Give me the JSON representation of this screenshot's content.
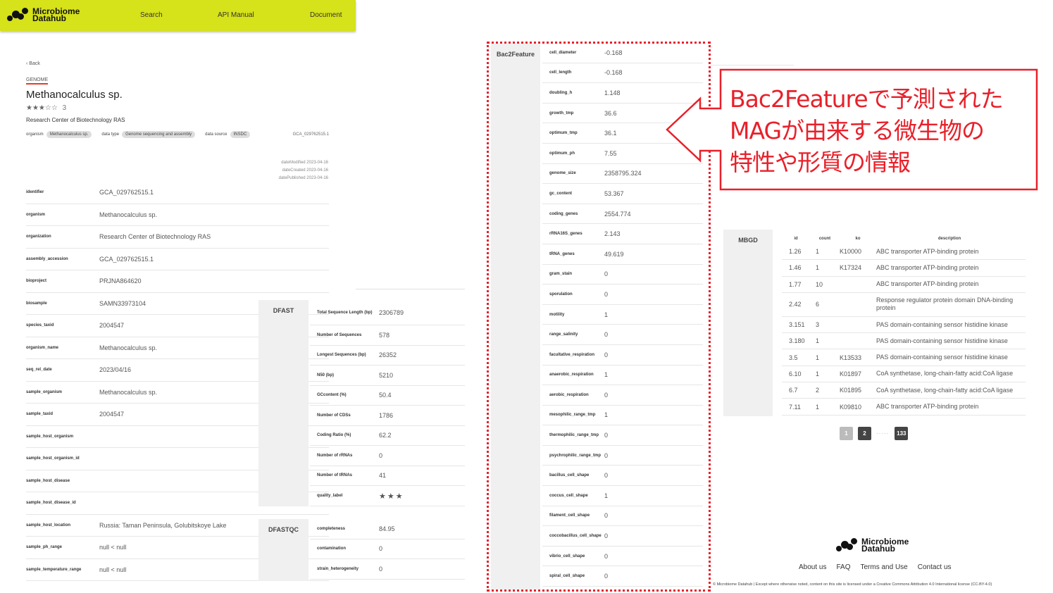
{
  "header": {
    "logo_line1": "Microbiome",
    "logo_line2": "Datahub",
    "nav": [
      "Search",
      "API Manual",
      "Document"
    ]
  },
  "left": {
    "back": "‹ Back",
    "type_tag": "GENOME",
    "title": "Methanocalculus sp.",
    "stars": "★★★☆☆",
    "rating_value": "3",
    "organization": "Research Center of Biotechnology RAS",
    "meta": [
      {
        "label": "organism",
        "value": "Methanocalculus sp."
      },
      {
        "label": "data type",
        "value": "Genome sequencing and assembly"
      },
      {
        "label": "data source",
        "value": "INSDC"
      }
    ],
    "accession_right": "GCA_029762515.1",
    "dates": [
      "dateModified 2023-04-16",
      "dateCreated 2023-04-16",
      "datePublished 2023-04-16"
    ],
    "rows": [
      {
        "k": "identifier",
        "v": "GCA_029762515.1"
      },
      {
        "k": "organism",
        "v": "Methanocalculus sp."
      },
      {
        "k": "organization",
        "v": "Research Center of Biotechnology RAS"
      },
      {
        "k": "assembly_accession",
        "v": "GCA_029762515.1"
      },
      {
        "k": "bioproject",
        "v": "PRJNA864620"
      },
      {
        "k": "biosample",
        "v": "SAMN33973104"
      },
      {
        "k": "species_taxid",
        "v": "2004547"
      },
      {
        "k": "organism_name",
        "v": "Methanocalculus sp."
      },
      {
        "k": "seq_rel_date",
        "v": "2023/04/16"
      },
      {
        "k": "sample_organism",
        "v": "Methanocalculus sp."
      },
      {
        "k": "sample_taxid",
        "v": "2004547"
      },
      {
        "k": "sample_host_organism",
        "v": ""
      },
      {
        "k": "sample_host_organism_id",
        "v": ""
      },
      {
        "k": "sample_host_disease",
        "v": ""
      },
      {
        "k": "sample_host_disease_id",
        "v": ""
      },
      {
        "k": "sample_host_location",
        "v": "Russia: Taman Peninsula, Golubitskoye Lake"
      },
      {
        "k": "sample_ph_range",
        "v": "null < null"
      },
      {
        "k": "sample_temperature_range",
        "v": "null < null"
      }
    ]
  },
  "dfast": {
    "label": "DFAST",
    "rows": [
      {
        "k": "Total Sequence Length (bp)",
        "v": "2306789"
      },
      {
        "k": "Number of Sequences",
        "v": "578"
      },
      {
        "k": "Longest Sequences (bp)",
        "v": "26352"
      },
      {
        "k": "N50 (bp)",
        "v": "5210"
      },
      {
        "k": "GCcontent (%)",
        "v": "50.4"
      },
      {
        "k": "Number of CDSs",
        "v": "1786"
      },
      {
        "k": "Coding Ratio (%)",
        "v": "62.2"
      },
      {
        "k": "Number of rRNAs",
        "v": "0"
      },
      {
        "k": "Number of tRNAs",
        "v": "41"
      },
      {
        "k": "quality_label",
        "v": "★★★"
      }
    ]
  },
  "dfastqc": {
    "label": "DFASTQC",
    "rows": [
      {
        "k": "completeness",
        "v": "84.95"
      },
      {
        "k": "contamination",
        "v": "0"
      },
      {
        "k": "strain_heterogeneity",
        "v": "0"
      }
    ]
  },
  "bac2feature": {
    "label": "Bac2Feature",
    "rows": [
      {
        "k": "cell_diameter",
        "v": "-0.168"
      },
      {
        "k": "cell_length",
        "v": "-0.168"
      },
      {
        "k": "doubling_h",
        "v": "1.148"
      },
      {
        "k": "growth_tmp",
        "v": "36.6"
      },
      {
        "k": "optimum_tmp",
        "v": "36.1"
      },
      {
        "k": "optimum_ph",
        "v": "7.55"
      },
      {
        "k": "genome_size",
        "v": "2358795.324"
      },
      {
        "k": "gc_content",
        "v": "53.367"
      },
      {
        "k": "coding_genes",
        "v": "2554.774"
      },
      {
        "k": "rRNA16S_genes",
        "v": "2.143"
      },
      {
        "k": "tRNA_genes",
        "v": "49.619"
      },
      {
        "k": "gram_stain",
        "v": "0"
      },
      {
        "k": "sporulation",
        "v": "0"
      },
      {
        "k": "motility",
        "v": "1"
      },
      {
        "k": "range_salinity",
        "v": "0"
      },
      {
        "k": "facultative_respiration",
        "v": "0"
      },
      {
        "k": "anaerobic_respiration",
        "v": "1"
      },
      {
        "k": "aerobic_respiration",
        "v": "0"
      },
      {
        "k": "mesophilic_range_tmp",
        "v": "1"
      },
      {
        "k": "thermophilic_range_tmp",
        "v": "0"
      },
      {
        "k": "psychrophilic_range_tmp",
        "v": "0"
      },
      {
        "k": "bacillus_cell_shape",
        "v": "0"
      },
      {
        "k": "coccus_cell_shape",
        "v": "1"
      },
      {
        "k": "filament_cell_shape",
        "v": "0"
      },
      {
        "k": "coccobacillus_cell_shape",
        "v": "0"
      },
      {
        "k": "vibrio_cell_shape",
        "v": "0"
      },
      {
        "k": "spiral_cell_shape",
        "v": "0"
      }
    ]
  },
  "callout": {
    "lines": [
      "Bac2Featureで予測された",
      "MAGが由来する微生物の",
      "特性や形質の情報"
    ],
    "color": "#e8202a"
  },
  "mbgd": {
    "label": "MBGD",
    "headers": {
      "id": "id",
      "count": "count",
      "ko": "ko",
      "description": "description"
    },
    "rows": [
      {
        "id": "1.26",
        "count": "1",
        "ko": "K10000",
        "desc": "ABC transporter ATP-binding protein"
      },
      {
        "id": "1.46",
        "count": "1",
        "ko": "K17324",
        "desc": "ABC transporter ATP-binding protein"
      },
      {
        "id": "1.77",
        "count": "10",
        "ko": "",
        "desc": "ABC transporter ATP-binding protein"
      },
      {
        "id": "2.42",
        "count": "6",
        "ko": "",
        "desc": "Response regulator protein domain DNA-binding protein"
      },
      {
        "id": "3.151",
        "count": "3",
        "ko": "",
        "desc": "PAS domain-containing sensor histidine kinase"
      },
      {
        "id": "3.180",
        "count": "1",
        "ko": "",
        "desc": "PAS domain-containing sensor histidine kinase"
      },
      {
        "id": "3.5",
        "count": "1",
        "ko": "K13533",
        "desc": "PAS domain-containing sensor histidine kinase"
      },
      {
        "id": "6.10",
        "count": "1",
        "ko": "K01897",
        "desc": "CoA synthetase, long-chain-fatty acid:CoA ligase"
      },
      {
        "id": "6.7",
        "count": "2",
        "ko": "K01895",
        "desc": "CoA synthetase, long-chain-fatty acid:CoA ligase"
      },
      {
        "id": "7.11",
        "count": "1",
        "ko": "K09810",
        "desc": "ABC transporter ATP-binding protein"
      }
    ],
    "pager": {
      "p1": "1",
      "p2": "2",
      "dots": "·····",
      "last": "133"
    }
  },
  "footer": {
    "logo_line1": "Microbiome",
    "logo_line2": "Datahub",
    "links": [
      "About us",
      "FAQ",
      "Terms and Use",
      "Contact us"
    ],
    "copyright": "© Microbiome Datahub | Except where otherwise noted, content on this site is licensed under a Creative Commons Attribution 4.0 International license (CC-BY-4.0)"
  }
}
